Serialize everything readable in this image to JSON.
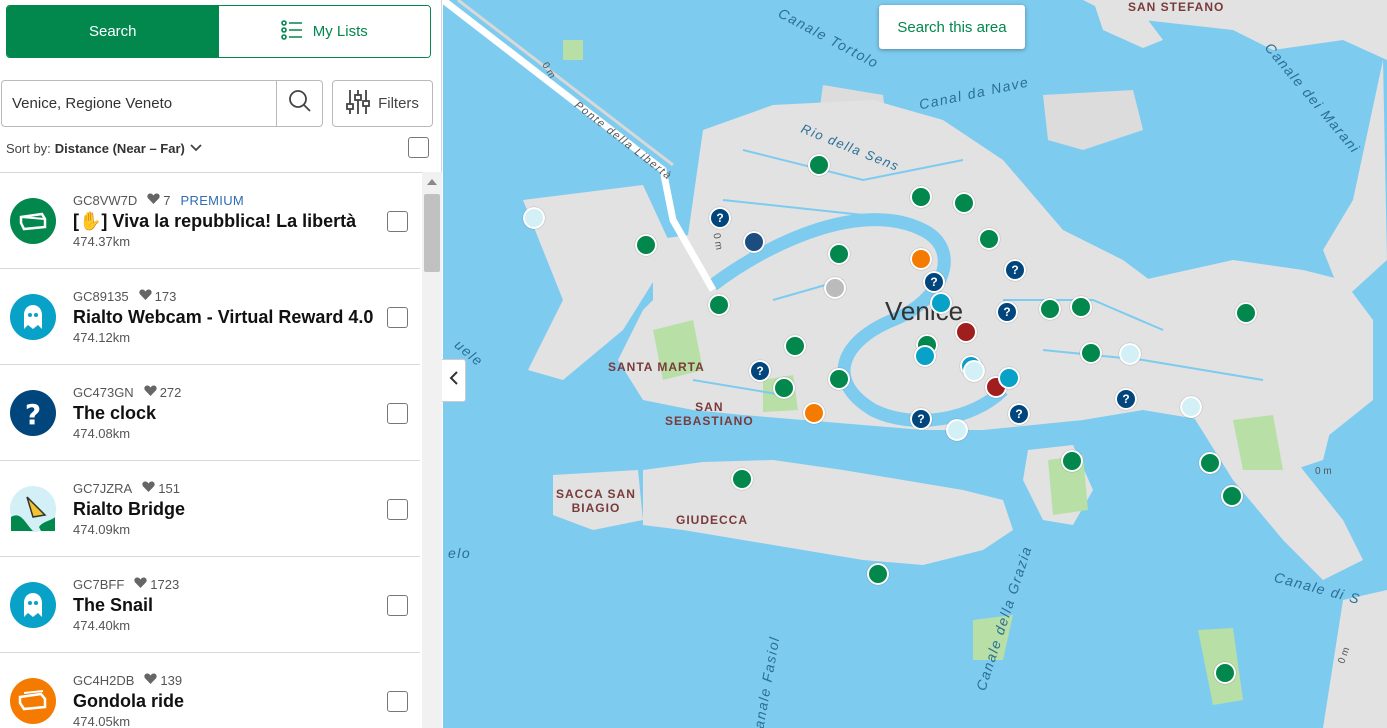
{
  "tabs": {
    "search": "Search",
    "my_lists": "My Lists"
  },
  "search": {
    "value": "Venice, Regione Veneto",
    "placeholder": ""
  },
  "filters_label": "Filters",
  "sort": {
    "prefix": "Sort by:",
    "value": "Distance (Near – Far)"
  },
  "results": [
    {
      "code": "GC8VW7D",
      "favorites": "7",
      "premium": "PREMIUM",
      "name": "[✋] Viva la repubblica! La libertà",
      "distance": "474.37km",
      "type": "traditional",
      "color": "#02874d",
      "icon": "traditional-cache-icon"
    },
    {
      "code": "GC89135",
      "favorites": "173",
      "premium": "",
      "name": "Rialto Webcam - Virtual Reward 4.0",
      "distance": "474.12km",
      "type": "virtual",
      "color": "#08a1c7",
      "icon": "ghost-icon"
    },
    {
      "code": "GC473GN",
      "favorites": "272",
      "premium": "",
      "name": "The clock",
      "distance": "474.08km",
      "type": "mystery",
      "color": "#00467c",
      "icon": "question-mark-icon"
    },
    {
      "code": "GC7JZRA",
      "favorites": "151",
      "premium": "",
      "name": "Rialto Bridge",
      "distance": "474.09km",
      "type": "earthcache",
      "color": "#d3f0f7",
      "icon": "earthcache-icon"
    },
    {
      "code": "GC7BFF",
      "favorites": "1723",
      "premium": "",
      "name": "The Snail",
      "distance": "474.40km",
      "type": "virtual",
      "color": "#08a1c7",
      "icon": "ghost-icon"
    },
    {
      "code": "GC4H2DB",
      "favorites": "139",
      "premium": "",
      "name": "Gondola ride",
      "distance": "474.05km",
      "type": "multi",
      "color": "#f57b00",
      "icon": "multi-cache-icon"
    }
  ],
  "map": {
    "search_area_label": "Search this area",
    "city": "Venice",
    "labels": {
      "santa_marta": "SANTA MARTA",
      "san_sebastiano": "SAN\nSEBASTIANO",
      "sacca_san_biagio": "SACCA SAN\nBIAGIO",
      "giudecca": "GIUDECCA",
      "san_stefano": "SAN STEFANO"
    },
    "water": {
      "canale_tortolo": "Canale Tortolo",
      "canal_da_nave": "Canal da Nave",
      "rio_della_sens": "Rio della Sens",
      "canale_dei_marani": "Canale dei Marani",
      "canale_della_grazia": "Canale della Grazia",
      "canale_di_san_marco": "Canale di S",
      "canale_fasiol": "Canale Fasiol",
      "ponte_della_liberta": "Ponte della Libertà"
    },
    "scale_labels": [
      "0 m",
      "0 m",
      "0 m",
      "0 m"
    ],
    "partial_labels": [
      "uele",
      "elo"
    ]
  },
  "colors": {
    "brand": "#02874d",
    "water": "#7ecbf0",
    "land": "#e2e2e2",
    "park": "#b8dfa5"
  }
}
